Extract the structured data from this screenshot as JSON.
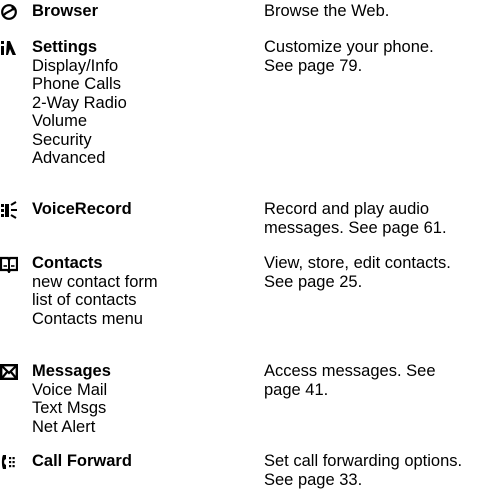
{
  "items": [
    {
      "icon": "browser-icon",
      "title": "Browser",
      "subs": [],
      "desc": [
        "Browse the Web."
      ]
    },
    {
      "icon": "settings-icon",
      "title": "Settings",
      "subs": [
        "Display/Info",
        "Phone Calls",
        "2-Way Radio",
        "Volume",
        "Security",
        "Advanced"
      ],
      "desc": [
        "Customize your phone.",
        "See page 79."
      ]
    },
    {
      "icon": "voicerecord-icon",
      "title": "VoiceRecord",
      "subs": [],
      "desc": [
        "Record and play audio",
        "messages. See page 61."
      ]
    },
    {
      "icon": "contacts-icon",
      "title": "Contacts",
      "subs": [
        "new contact form",
        "list of contacts",
        "Contacts menu"
      ],
      "desc": [
        "View, store, edit contacts.",
        "See page 25."
      ]
    },
    {
      "icon": "messages-icon",
      "title": "Messages",
      "subs": [
        "Voice Mail",
        "Text Msgs",
        "Net Alert"
      ],
      "desc": [
        "Access messages. See",
        "page 41."
      ]
    },
    {
      "icon": "call-forward-icon",
      "title": "Call Forward",
      "subs": [],
      "desc": [
        "Set call forwarding options.",
        "See page 33."
      ]
    }
  ]
}
